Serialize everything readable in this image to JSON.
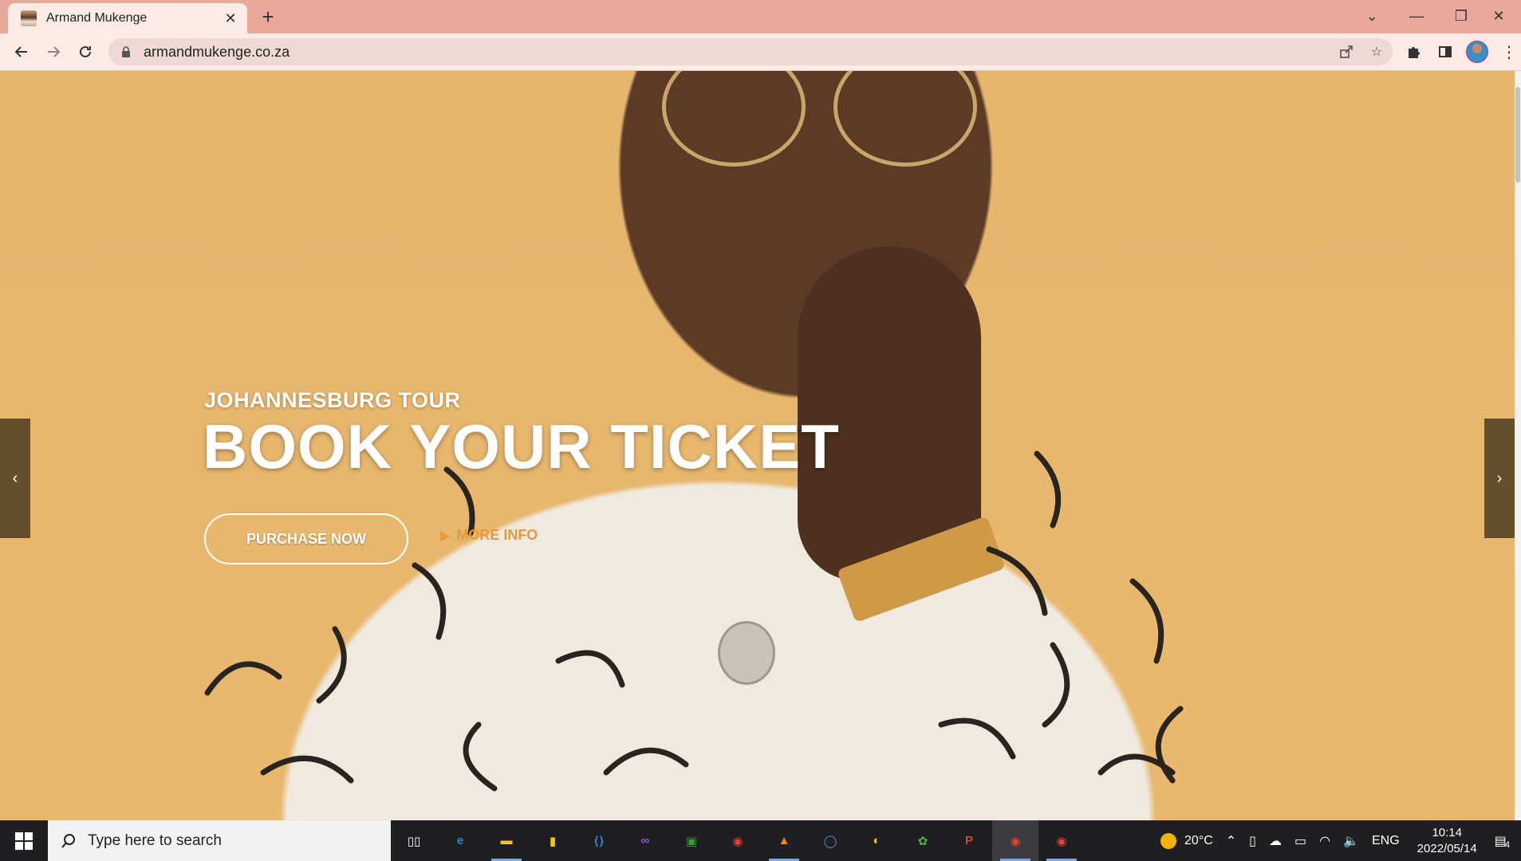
{
  "browser": {
    "tab_title": "Armand Mukenge",
    "url": "armandmukenge.co.za",
    "icons": {
      "favicon": "person-photo-favicon",
      "close_tab": "close-icon",
      "new_tab": "plus-icon",
      "tab_search": "chevron-down-icon",
      "minimize": "minimize-icon",
      "restore": "restore-icon",
      "close_window": "close-icon",
      "back": "arrow-left-icon",
      "forward": "arrow-right-icon",
      "reload": "reload-icon",
      "lock": "lock-icon",
      "share": "share-icon",
      "bookmark": "star-icon",
      "extensions": "puzzle-icon",
      "side_panel": "side-panel-icon",
      "profile": "avatar",
      "menu": "kebab-menu-icon"
    }
  },
  "hero": {
    "subtitle": "JOHANNESBURG TOUR",
    "headline": "BOOK YOUR TICKET",
    "purchase_button": "PURCHASE NOW",
    "more_info_button": "MORE INFO",
    "accent_color": "#e59a3a",
    "prev_arrow": "‹",
    "next_arrow": "›"
  },
  "taskbar": {
    "search_placeholder": "Type here to search",
    "apps": [
      {
        "name": "task-view",
        "glyph": "▯▯"
      },
      {
        "name": "edge",
        "glyph": "e",
        "color": "#1b8ad8"
      },
      {
        "name": "file-explorer",
        "glyph": "▬",
        "color": "#f2c432"
      },
      {
        "name": "power-bi",
        "glyph": "▮",
        "color": "#f2c811"
      },
      {
        "name": "vs-code",
        "glyph": "⟨⟩",
        "color": "#2a8be0"
      },
      {
        "name": "visual-studio",
        "glyph": "∞",
        "color": "#8b57d1"
      },
      {
        "name": "image-app",
        "glyph": "▣",
        "color": "#3a9a3a"
      },
      {
        "name": "chrome",
        "glyph": "◉",
        "color": "#e34133"
      },
      {
        "name": "vlc",
        "glyph": "▲",
        "color": "#f28a1a"
      },
      {
        "name": "cortana",
        "glyph": "◯",
        "color": "#6b8ec9"
      },
      {
        "name": "photos",
        "glyph": "◐",
        "color": "#f0c419"
      },
      {
        "name": "collage-app",
        "glyph": "✿",
        "color": "#4bb34b"
      },
      {
        "name": "powerpoint",
        "glyph": "P",
        "color": "#d24726"
      },
      {
        "name": "chrome-profile-1",
        "glyph": "◉",
        "color": "#e34133"
      },
      {
        "name": "chrome-profile-2",
        "glyph": "◉",
        "color": "#e34133"
      }
    ],
    "weather": "20°C",
    "language": "ENG",
    "time": "10:14",
    "date": "2022/05/14",
    "notifications": "4"
  }
}
